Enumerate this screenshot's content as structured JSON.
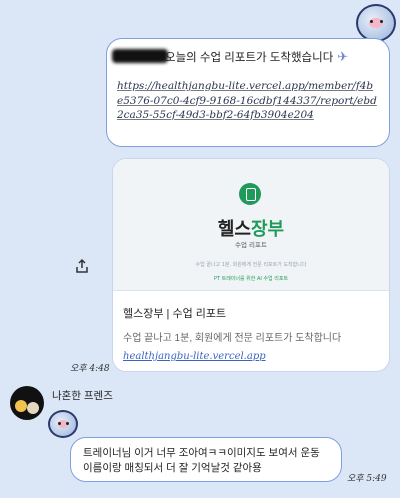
{
  "message1": {
    "text_visible": "오늘의 수업 리포트가 도착했습니다",
    "icon": "paper-plane-icon",
    "link": "https://healthjangbu-lite.vercel.app/member/f4be5376-07c0-4cf9-9168-16cdbf144337/report/ebd2ca35-55cf-49d3-bbf2-64fb3904e204"
  },
  "link_preview": {
    "brand_prefix": "헬스",
    "brand_accent": "장부",
    "brand_sub": "수업 리포트",
    "brand_desc": "수업 끝나고 1분, 회원에게 전문 리포트가 도착합니다",
    "brand_tag": "PT 트레이너를 위한 AI 수업 리포트",
    "title": "헬스장부 | 수업 리포트",
    "description": "수업 끝나고 1분, 회원에게 전문 리포트가 도착합니다",
    "url": "healthjangbu-lite.vercel.app"
  },
  "timestamps": {
    "sent": "오후 4:48",
    "received": "오후 5:49"
  },
  "sender": {
    "name": "나혼한 프렌즈"
  },
  "message2": {
    "text": "트레이너님 이거 너무 조아여ㅋㅋ이미지도 보여서 운동 이름이랑 매칭되서 더 잘 기억날것 같아용"
  },
  "colors": {
    "background": "#dbe7f6",
    "bubble_border": "#7f9fe0",
    "brand_green": "#1f9a5a",
    "link_blue": "#3a64c2"
  }
}
